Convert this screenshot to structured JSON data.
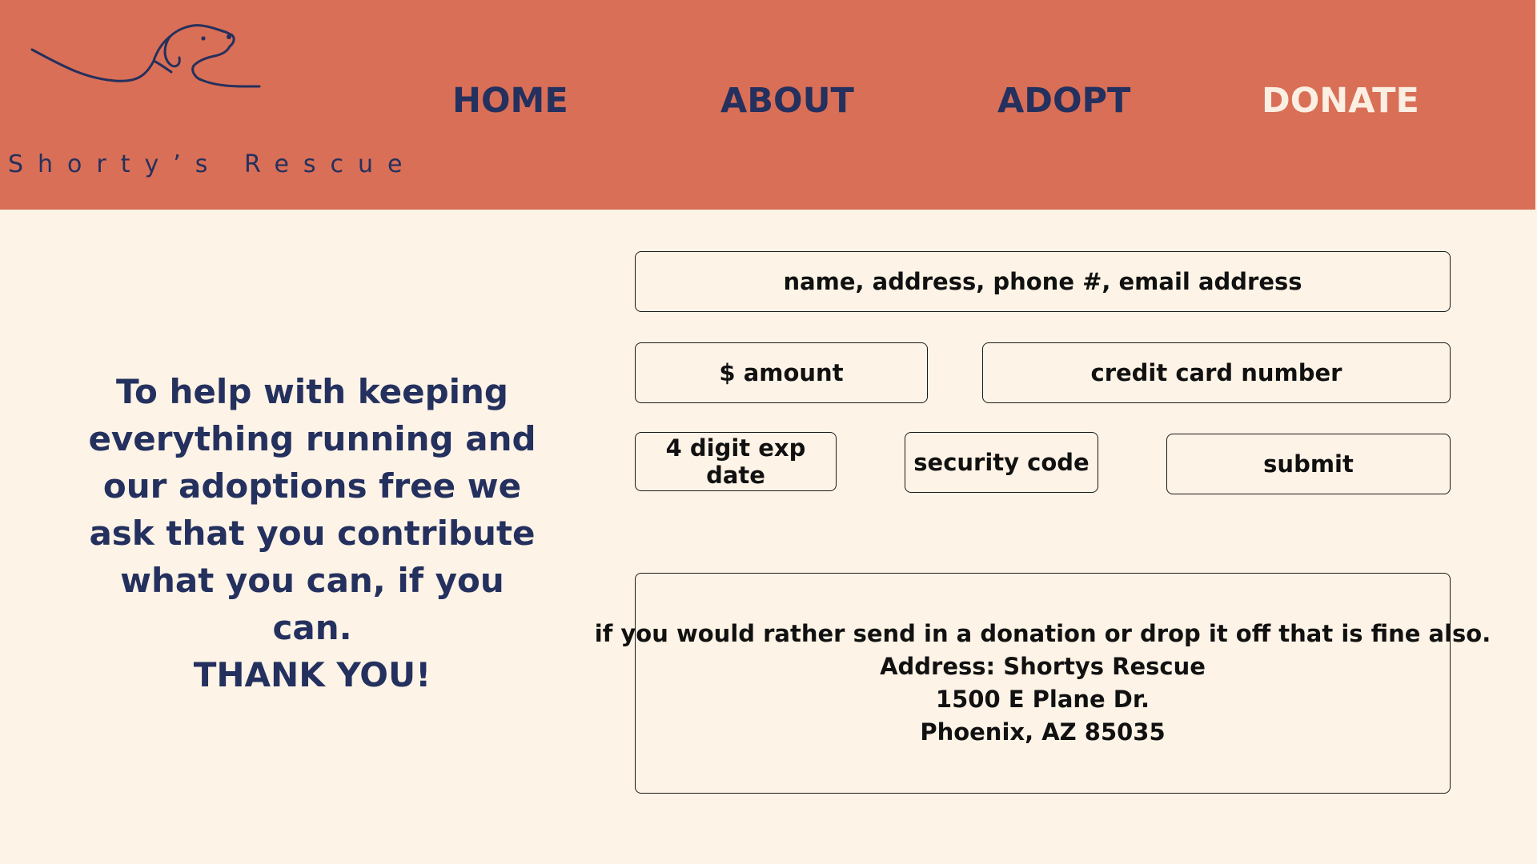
{
  "header": {
    "brand_name": "Shorty’s Rescue",
    "logo_icon": "dog-line-art-logo-icon",
    "colors": {
      "header_bg": "#d96f56",
      "nav_text": "#24305e",
      "active_nav_text": "#fbeee2",
      "page_bg": "#fdf3e6"
    }
  },
  "nav": {
    "items": [
      {
        "label": "HOME"
      },
      {
        "label": "ABOUT"
      },
      {
        "label": "ADOPT"
      },
      {
        "label": "DONATE",
        "active": true
      }
    ]
  },
  "intro": {
    "message": "To help with keeping everything running and our adoptions free we ask that you contribute what you can, if you can.",
    "thanks": "THANK YOU!"
  },
  "form": {
    "contact_placeholder": "name, address, phone #, email address",
    "amount_placeholder": "$ amount",
    "card_placeholder": "credit card number",
    "exp_placeholder": "4 digit exp date",
    "security_placeholder": "security code",
    "submit_label": "submit"
  },
  "mail_info": {
    "line1": "if you would rather send in a donation or drop it off that is fine also.",
    "line2": "Address: Shortys Rescue",
    "line3": "1500 E Plane Dr.",
    "line4": "Phoenix, AZ 85035"
  }
}
